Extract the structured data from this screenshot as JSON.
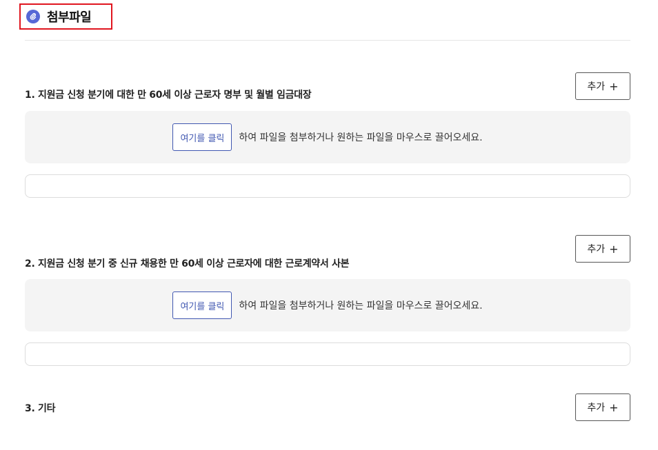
{
  "header": {
    "title": "첨부파일",
    "icon": "attachment-icon",
    "accent_color": "#5668d6",
    "highlight_color": "#e0141e"
  },
  "sections": [
    {
      "label": "1. 지원금 신청 분기에 대한 만 60세 이상 근로자 명부 및 월별 임금대장",
      "add_label": "추가",
      "add_icon": "+",
      "click_label": "여기를 클릭",
      "drop_text": "하여 파일을 첨부하거나 원하는 파일을 마우스로 끌어오세요."
    },
    {
      "label": "2. 지원금 신청 분기 중 신규 채용한 만 60세 이상 근로자에 대한 근로계약서 사본",
      "add_label": "추가",
      "add_icon": "+",
      "click_label": "여기를 클릭",
      "drop_text": "하여 파일을 첨부하거나 원하는 파일을 마우스로 끌어오세요."
    },
    {
      "label": "3. 기타",
      "add_label": "추가",
      "add_icon": "+"
    }
  ],
  "colors": {
    "dropzone_bg": "#f4f4f4",
    "link_blue": "#3f56b0"
  }
}
